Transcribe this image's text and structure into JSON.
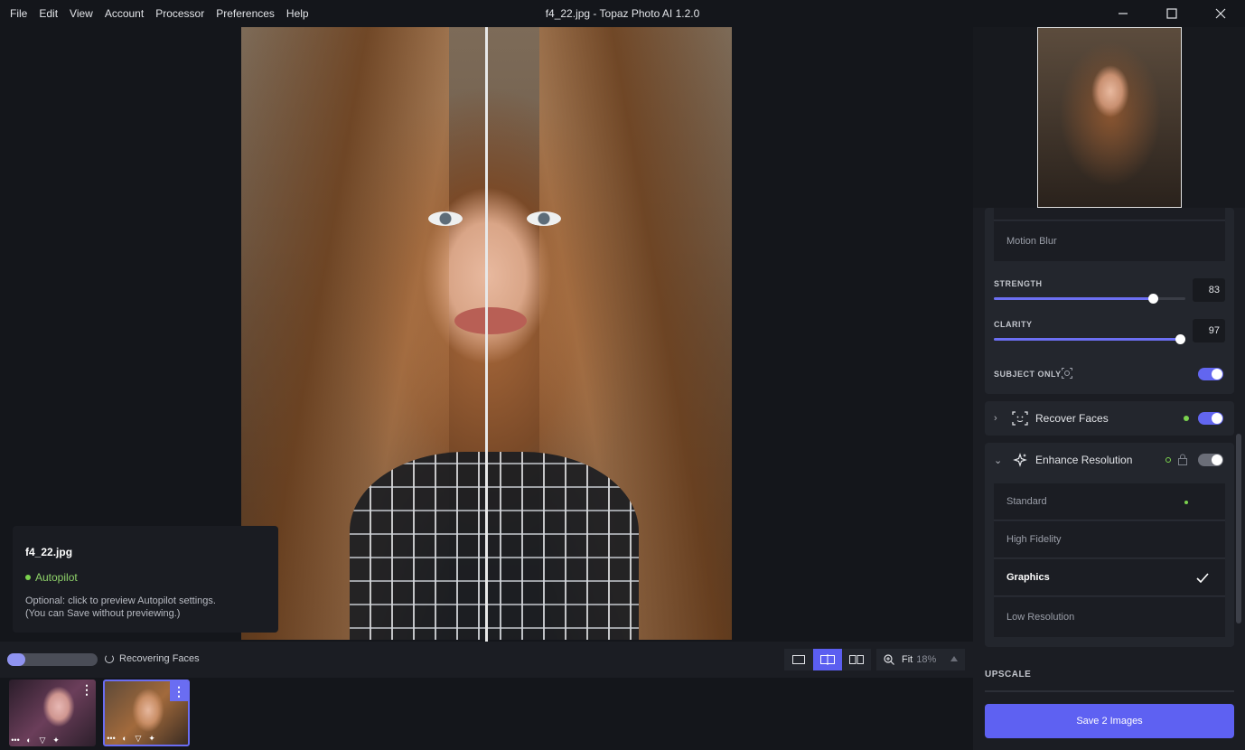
{
  "window": {
    "title": "f4_22.jpg - Topaz Photo AI 1.2.0",
    "menu": [
      "File",
      "Edit",
      "View",
      "Account",
      "Processor",
      "Preferences",
      "Help"
    ]
  },
  "info_card": {
    "filename": "f4_22.jpg",
    "autopilot": "Autopilot",
    "line1": "Optional: click to preview Autopilot settings.",
    "line2": "(You can Save without previewing.)"
  },
  "status": {
    "progress_fraction": 0.2,
    "label": "Recovering Faces"
  },
  "zoom": {
    "fit_label": "Fit",
    "percent": "18%"
  },
  "panel": {
    "motion_blur_option": "Motion Blur",
    "strength": {
      "label": "STRENGTH",
      "value": "83",
      "fraction": 0.83
    },
    "clarity": {
      "label": "CLARITY",
      "value": "97",
      "fraction": 0.97
    },
    "subject_only": {
      "label": "SUBJECT ONLY",
      "enabled": true
    },
    "recover_faces": {
      "title": "Recover Faces",
      "enabled": true
    },
    "enhance_resolution": {
      "title": "Enhance Resolution",
      "enabled": false,
      "models": [
        "Standard",
        "High Fidelity",
        "Graphics",
        "Low Resolution"
      ],
      "selected": "Graphics"
    },
    "upscale_label": "UPSCALE",
    "save_button": "Save 2 Images"
  },
  "colors": {
    "accent": "#5e61f2",
    "autopilot_green": "#7bd24e"
  }
}
